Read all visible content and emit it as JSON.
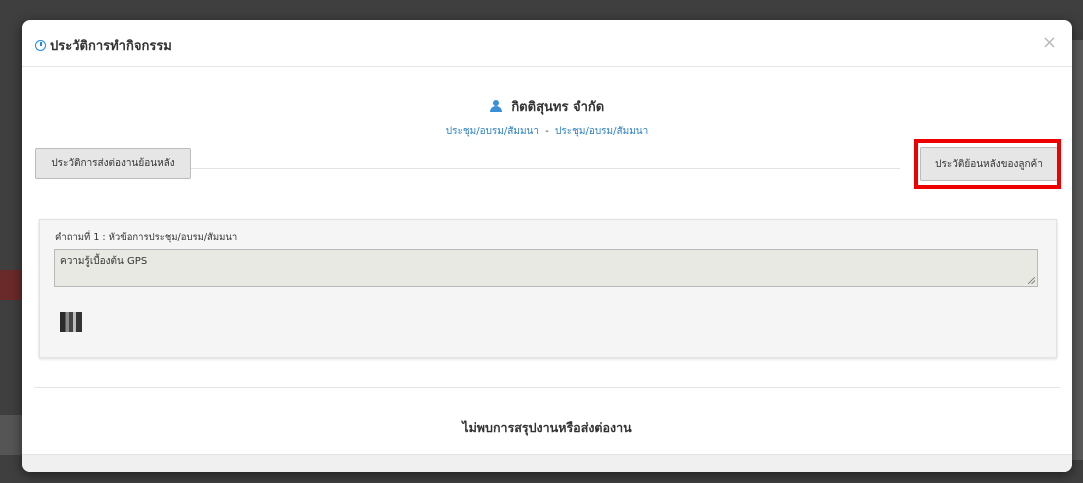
{
  "modal": {
    "title": "ประวัติการทำกิจกรรม",
    "close_label": "×"
  },
  "customer": {
    "name": "กิตติสุนทร จำกัด",
    "activity_parts": [
      "ประชุม/อบรม/สัมมนา",
      "-",
      "ประชุม/อบรม/สัมมนา"
    ]
  },
  "buttons": {
    "history_forward": "ประวัติการส่งต่องานย้อนหลัง",
    "customer_history": "ประวัติย้อนหลังของลูกค้า"
  },
  "question": {
    "label": "คำถามที่ 1 : หัวข้อการประชุม/อบรม/สัมมนา",
    "answer": "ความรู้เบื้องต้น GPS"
  },
  "empty_state": "ไม่พบการสรุปงานหรือส่งต่องาน",
  "colors": {
    "accent": "#2a7fc8",
    "highlight": "#e00000"
  }
}
